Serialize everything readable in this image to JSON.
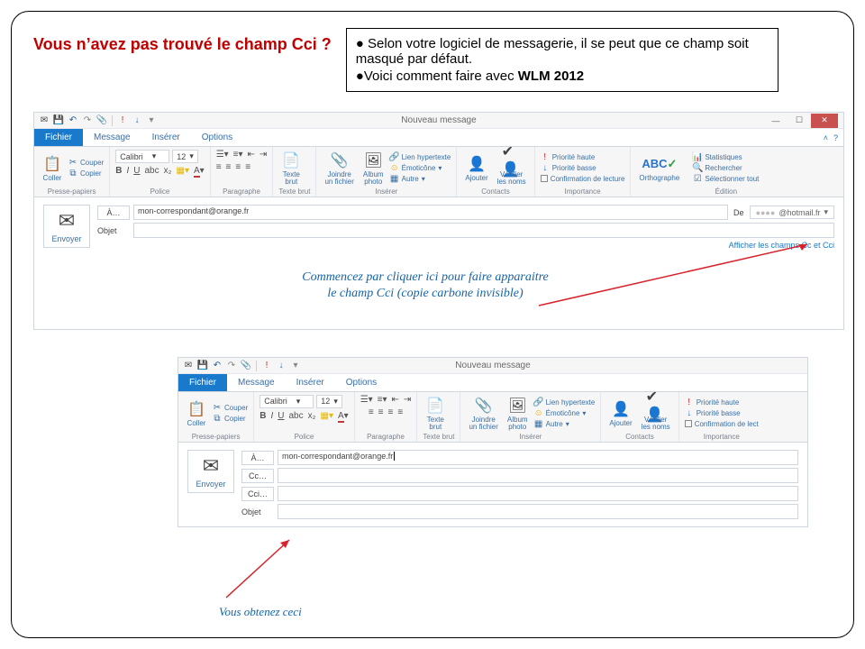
{
  "heading": "Vous n’avez pas trouvé le champ Cci ?",
  "info": {
    "line1": "Selon votre logiciel de messagerie, il se peut que ce champ soit masqué par défaut.",
    "line2_prefix": "Voici comment faire avec ",
    "line2_bold": "WLM 2012"
  },
  "win": {
    "title": "Nouveau message",
    "tabs": {
      "fichier": "Fichier",
      "message": "Message",
      "inserer": "Insérer",
      "options": "Options"
    },
    "groups": {
      "clipboard": {
        "label": "Presse-papiers",
        "coller": "Coller",
        "couper": "Couper",
        "copier": "Copier"
      },
      "font": {
        "label": "Police",
        "name": "Calibri",
        "size": "12"
      },
      "para": {
        "label": "Paragraphe"
      },
      "plain": {
        "label": "Texte brut",
        "btn": "Texte\nbrut"
      },
      "insert": {
        "label": "Insérer",
        "joindre": "Joindre\nun fichier",
        "album": "Album\nphoto",
        "lien": "Lien hypertexte",
        "emot": "Émoticône",
        "autre": "Autre"
      },
      "contacts": {
        "label": "Contacts",
        "ajouter": "Ajouter",
        "verifier": "Vérifier\nles noms"
      },
      "importance": {
        "label": "Importance",
        "haute": "Priorité haute",
        "basse": "Priorité basse",
        "confirm": "Confirmation de lecture",
        "confirm_short": "Confirmation de lect"
      },
      "spell": {
        "btn": "Orthographe"
      },
      "edit": {
        "label": "Édition",
        "stats": "Statistiques",
        "rech": "Rechercher",
        "sel": "Sélectionner tout"
      }
    },
    "send": "Envoyer",
    "fields": {
      "a": "À…",
      "cc": "Cc…",
      "cci": "Cci…",
      "objet": "Objet",
      "de": "De",
      "addr": "mon-correspondant@orange.fr",
      "from_display": "@hotmail.fr"
    },
    "link_cc": "Afficher les champs Cc et Cci"
  },
  "annot": {
    "a1": "Commencez par cliquer ici pour faire apparaitre",
    "a2": "le champ Cci (copie carbone invisible)",
    "b": "Vous obtenez ceci"
  }
}
